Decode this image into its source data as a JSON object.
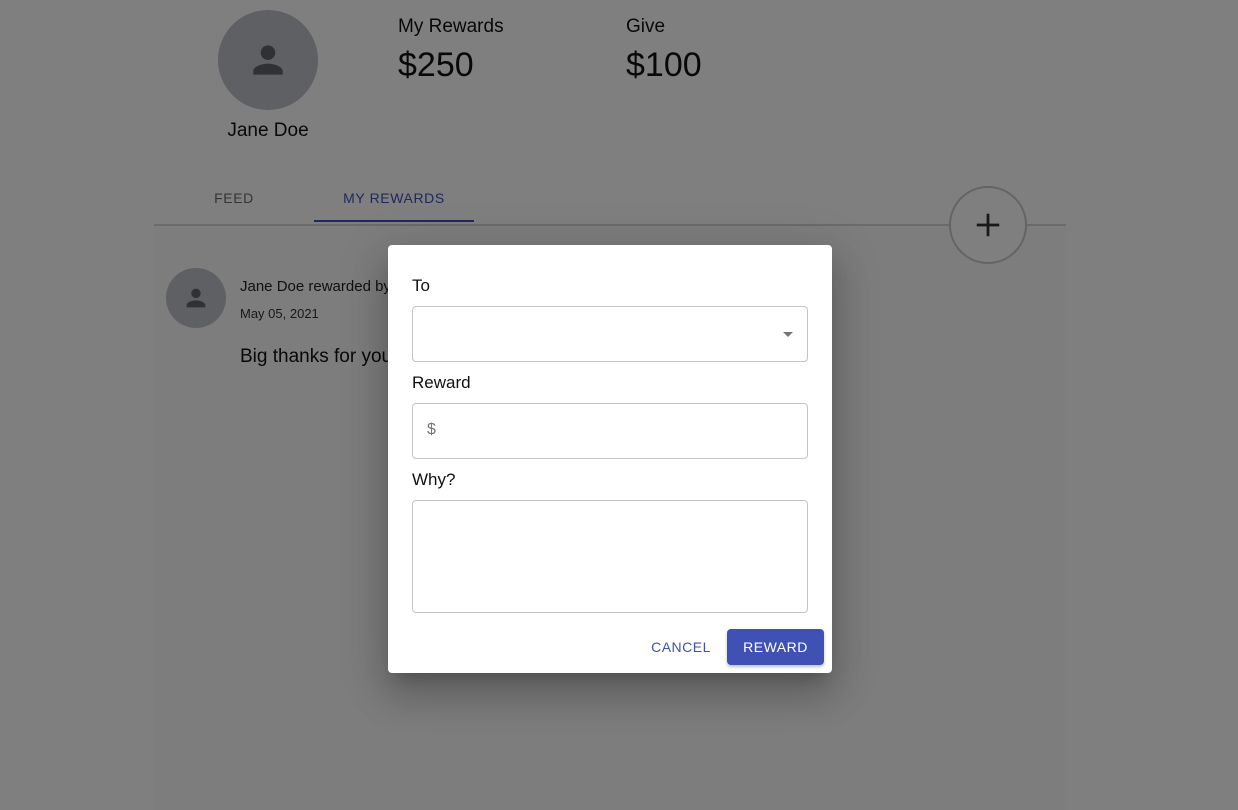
{
  "profile": {
    "name": "Jane Doe",
    "avatar_icon": "person-icon"
  },
  "stats": {
    "my_rewards_label": "My Rewards",
    "my_rewards_value": "$250",
    "give_label": "Give",
    "give_value": "$100"
  },
  "tabs": [
    {
      "label": "FEED",
      "active": false
    },
    {
      "label": "MY REWARDS",
      "active": true
    }
  ],
  "fab": {
    "icon": "plus-icon"
  },
  "feed_item": {
    "avatar_icon": "person-icon",
    "title": "Jane Doe rewarded by",
    "date": "May 05, 2021",
    "message": "Big thanks for your"
  },
  "dialog": {
    "to_label": "To",
    "to_value": "",
    "reward_label": "Reward",
    "reward_adornment": "$",
    "reward_value": "",
    "why_label": "Why?",
    "why_value": "",
    "cancel_label": "CANCEL",
    "reward_button_label": "REWARD"
  },
  "colors": {
    "primary": "#3f51b5",
    "avatar_bg": "#bdc1c6",
    "overlay": "rgba(0,0,0,0.5)"
  }
}
